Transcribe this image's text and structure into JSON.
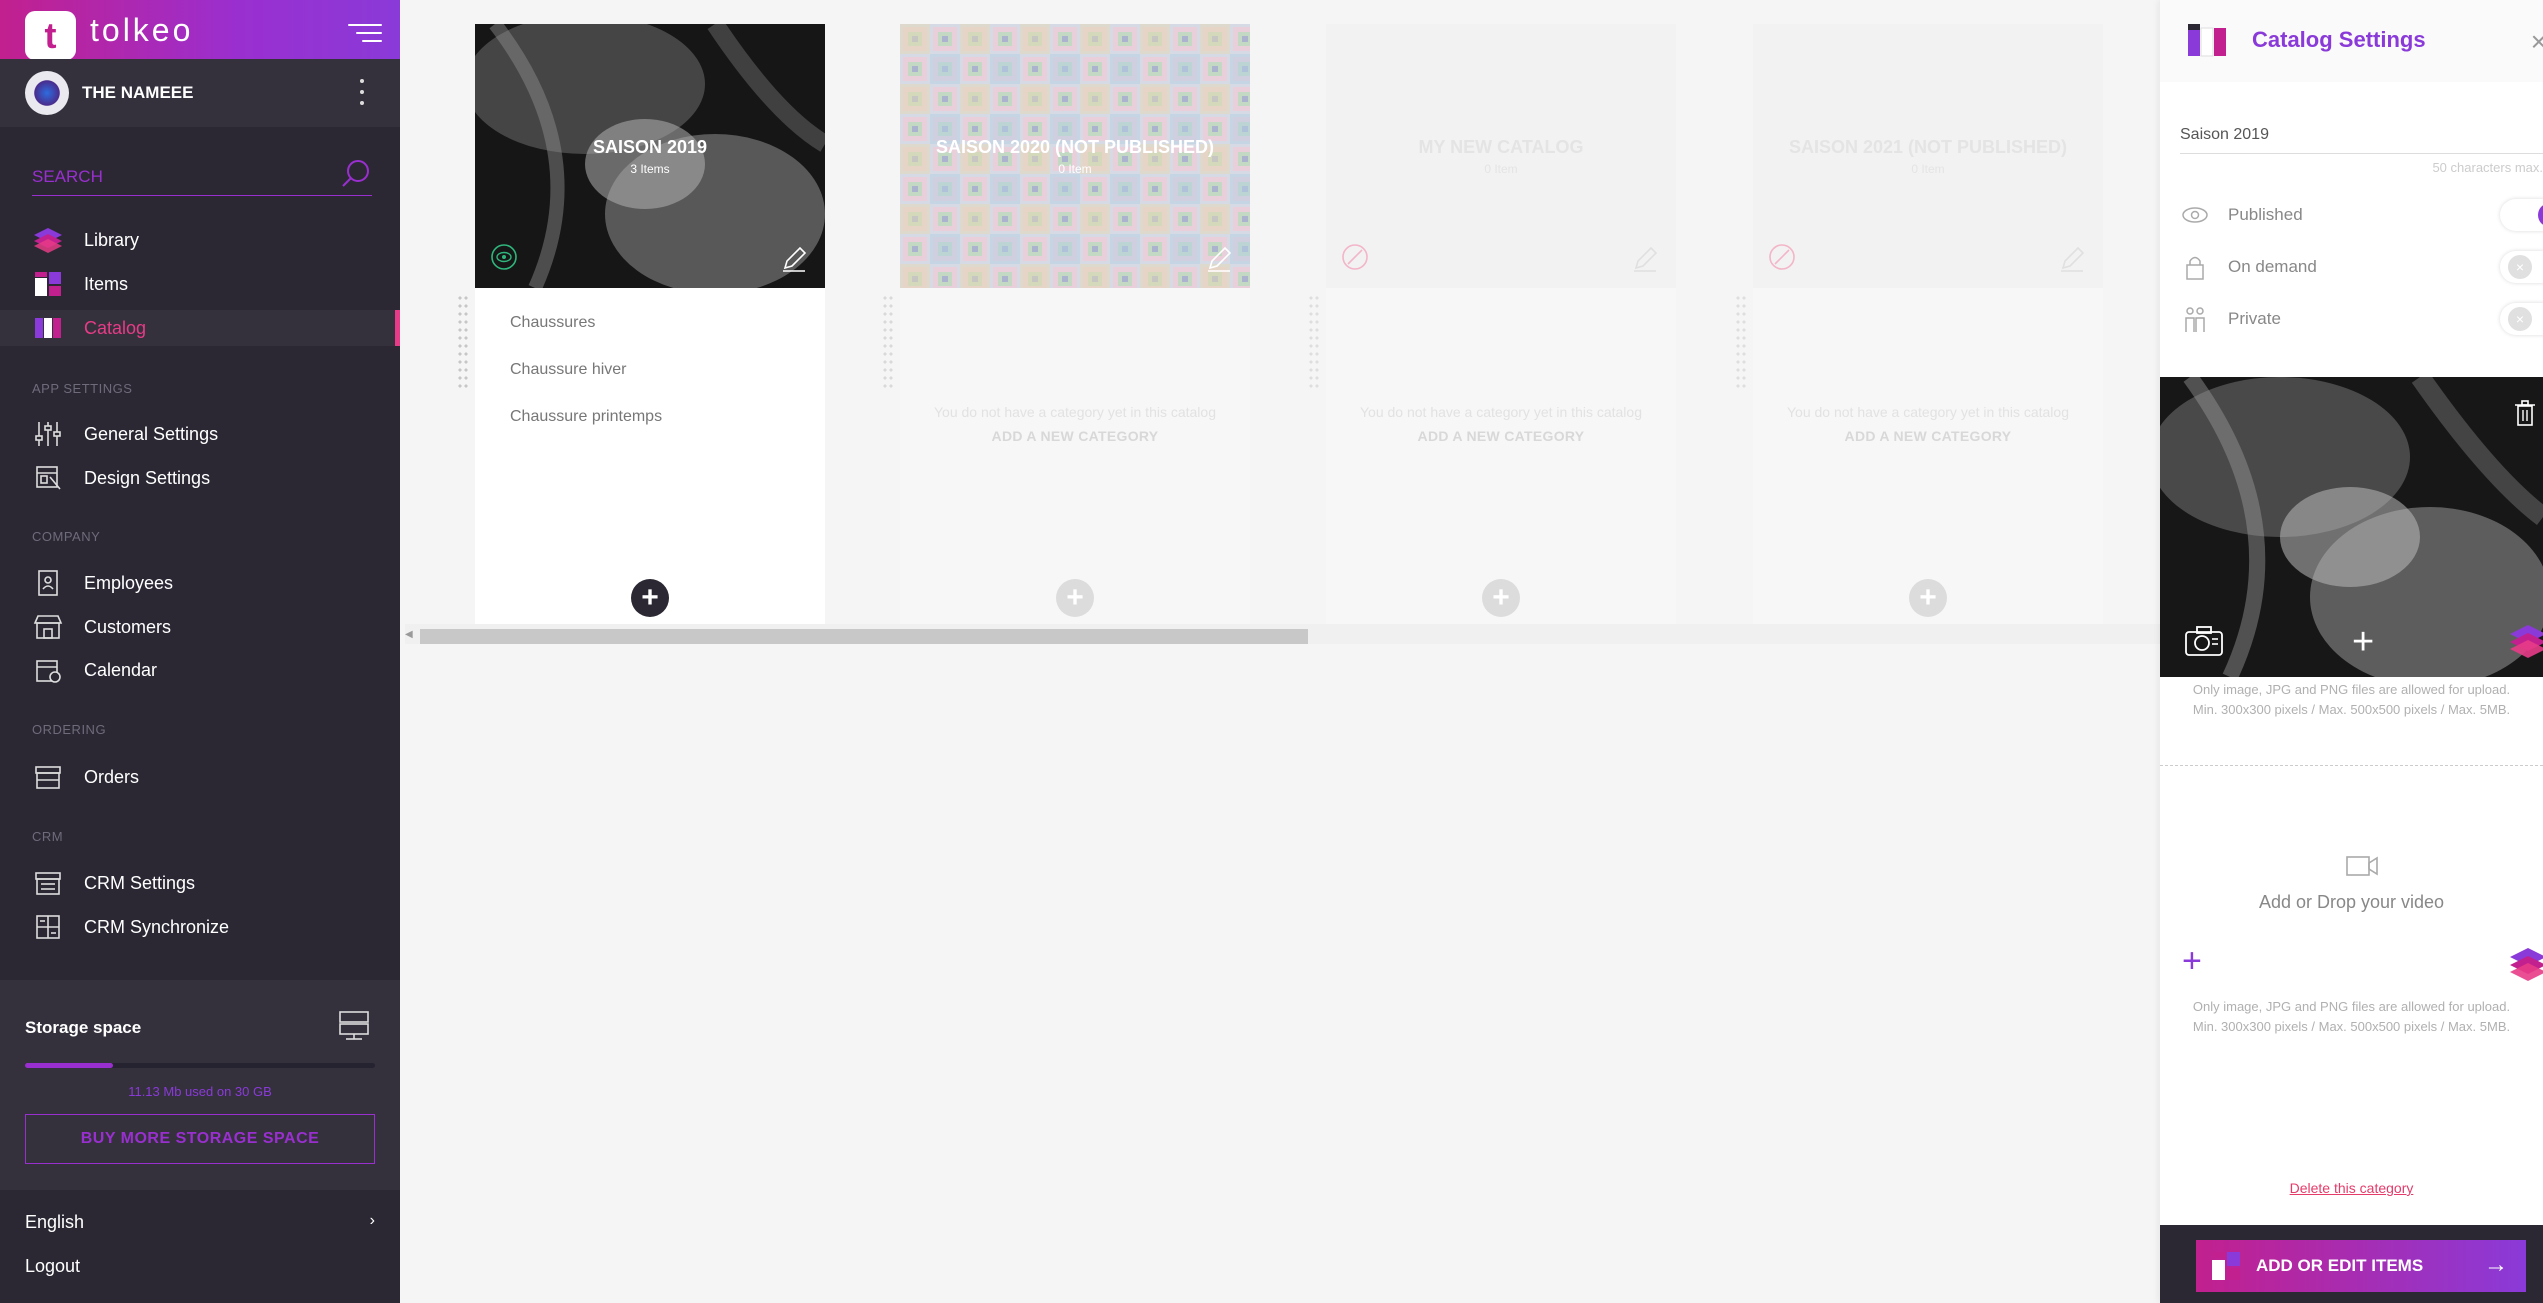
{
  "app": {
    "brand": "tolkeo",
    "logo_letter": "t"
  },
  "user": {
    "name": "THE NAMEEE"
  },
  "search": {
    "placeholder": "SEARCH"
  },
  "sidebar": {
    "nav": [
      {
        "label": "Library",
        "icon": "library-icon"
      },
      {
        "label": "Items",
        "icon": "items-icon"
      },
      {
        "label": "Catalog",
        "icon": "catalog-icon",
        "active": true
      }
    ],
    "sections": [
      {
        "label": "APP SETTINGS",
        "items": [
          {
            "label": "General Settings"
          },
          {
            "label": "Design Settings"
          }
        ]
      },
      {
        "label": "COMPANY",
        "items": [
          {
            "label": "Employees"
          },
          {
            "label": "Customers"
          },
          {
            "label": "Calendar"
          }
        ]
      },
      {
        "label": "ORDERING",
        "items": [
          {
            "label": "Orders"
          }
        ]
      },
      {
        "label": "CRM",
        "items": [
          {
            "label": "CRM Settings"
          },
          {
            "label": "CRM Synchronize"
          }
        ]
      }
    ],
    "storage": {
      "title": "Storage space",
      "usage_text": "11.13 Mb used on 30 GB",
      "fill_fraction": 0.25,
      "buy_label": "BUY MORE STORAGE SPACE"
    },
    "language": "English",
    "language_arrow": "›",
    "logout": "Logout"
  },
  "catalogs": [
    {
      "title": "SAISON 2019",
      "count": "3 Items",
      "categories": [
        "Chaussures",
        "Chaussure hiver",
        "Chaussure printemps"
      ],
      "add_symbol": "+"
    },
    {
      "title": "SAISON 2020 (NOT PUBLISHED)",
      "count": "0 Item",
      "empty_message": "You do not have a category yet in this catalog",
      "add_category": "ADD A NEW CATEGORY",
      "add_symbol": "+"
    },
    {
      "title": "MY NEW CATALOG",
      "count": "0 Item",
      "empty_message": "You do not have a category yet in this catalog",
      "add_category": "ADD A NEW CATEGORY",
      "add_symbol": "+"
    },
    {
      "title": "SAISON 2021 (NOT PUBLISHED)",
      "count": "0 Item",
      "empty_message": "You do not have a category yet in this catalog",
      "add_category": "ADD A NEW CATEGORY",
      "add_symbol": "+"
    }
  ],
  "panel": {
    "title": "Catalog Settings",
    "close_symbol": "×",
    "name_value": "Saison 2019",
    "char_limit": "50 characters max.",
    "toggles": [
      {
        "label": "Published",
        "icon": "eye-icon",
        "on": true,
        "symbol": "✓"
      },
      {
        "label": "On demand",
        "icon": "lock-icon",
        "on": false,
        "symbol": "×"
      },
      {
        "label": "Private",
        "icon": "people-icon",
        "on": false,
        "symbol": "×"
      }
    ],
    "image_plus": "+",
    "upload_note_1": "Only image, JPG and PNG files are allowed for upload.",
    "upload_note_2": "Min. 300x300 pixels / Max. 500x500 pixels / Max. 5MB.",
    "video_label": "Add or Drop your video",
    "video_plus": "+",
    "video_note_1": "Only image, JPG and PNG files are allowed for upload.",
    "video_note_2": "Min. 300x300 pixels / Max. 500x500 pixels / Max. 5MB.",
    "delete_label": "Delete this category",
    "add_edit_label": "ADD OR EDIT ITEMS",
    "add_edit_arrow": "→"
  },
  "colors": {
    "brand_pink": "#c2208e",
    "brand_purple": "#8a3ad8",
    "active_pink": "#e83b87",
    "sidebar_bg": "#2b2834",
    "published_green": "#2fb67c"
  }
}
